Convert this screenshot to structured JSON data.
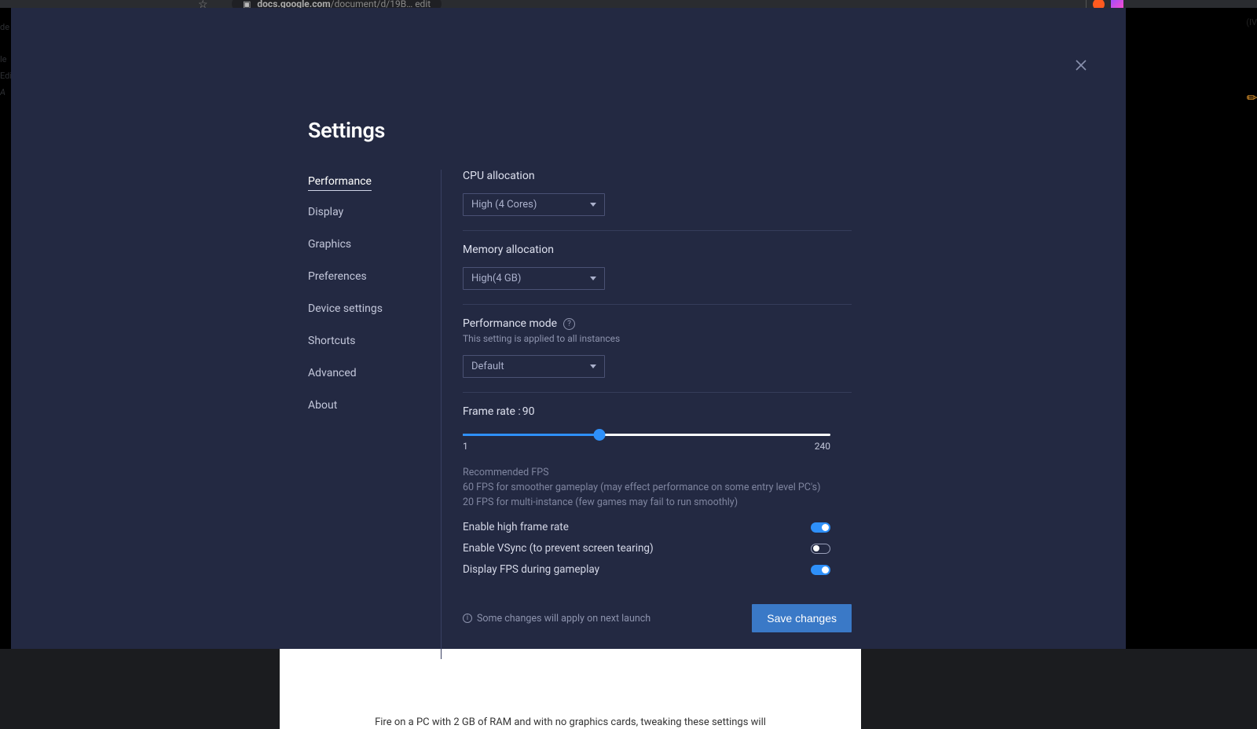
{
  "bg": {
    "url_prefix": "docs.google.com",
    "url_rest": "/document/d/19B… edit",
    "left1": "de",
    "left2": "le",
    "left3": "Edi",
    "left_icon": "A",
    "right": "(IV",
    "bottom_text": "Fire on a PC with 2 GB of RAM and with no graphics cards, tweaking these settings will"
  },
  "page_title": "Settings",
  "sidebar": {
    "items": [
      {
        "label": "Performance",
        "active": true
      },
      {
        "label": "Display"
      },
      {
        "label": "Graphics"
      },
      {
        "label": "Preferences"
      },
      {
        "label": "Device settings"
      },
      {
        "label": "Shortcuts"
      },
      {
        "label": "Advanced"
      },
      {
        "label": "About"
      }
    ]
  },
  "cpu": {
    "label": "CPU allocation",
    "value": "High (4 Cores)"
  },
  "memory": {
    "label": "Memory allocation",
    "value": "High(4 GB)"
  },
  "perfmode": {
    "label": "Performance mode",
    "sub": "This setting is applied to all instances",
    "value": "Default"
  },
  "frame": {
    "label_prefix": "Frame rate : ",
    "value": 90,
    "min": 1,
    "max": 240,
    "fill_pct": 37.2,
    "reco_title": "Recommended FPS",
    "reco_body": "60 FPS for smoother gameplay (may effect performance on some entry level PC's) 20 FPS for multi-instance (few games may fail to run smoothly)"
  },
  "toggles": {
    "high_frame": {
      "label": "Enable high frame rate",
      "on": true
    },
    "vsync": {
      "label": "Enable VSync (to prevent screen tearing)",
      "on": false
    },
    "display_fps": {
      "label": "Display FPS during gameplay",
      "on": true
    }
  },
  "footer": {
    "notice": "Some changes will apply on next launch",
    "save": "Save changes"
  }
}
